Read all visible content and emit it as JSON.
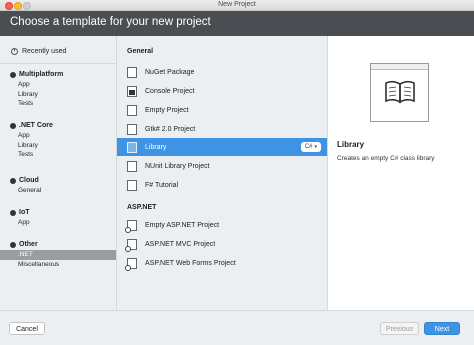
{
  "window": {
    "title": "New Project"
  },
  "header": {
    "title": "Choose a template for your new project"
  },
  "sidebar": {
    "recent_label": "Recently used",
    "groups": [
      {
        "label": "Multiplatform",
        "icon": "multiplatform-icon",
        "items": [
          "App",
          "Library",
          "Tests"
        ]
      },
      {
        "label": ".NET Core",
        "icon": "dotnet-core-icon",
        "items": [
          "App",
          "Library",
          "Tests"
        ]
      },
      {
        "label": "Cloud",
        "icon": "cloud-icon",
        "items": [
          "General"
        ]
      },
      {
        "label": "IoT",
        "icon": "iot-icon",
        "items": [
          "App"
        ]
      },
      {
        "label": "Other",
        "icon": "other-icon",
        "items": [
          ".NET",
          "Miscellaneous"
        ]
      }
    ],
    "selected": ".NET"
  },
  "templates": {
    "sections": [
      {
        "label": "General",
        "items": [
          {
            "label": "NuGet Package",
            "icon": "nuget-package-icon"
          },
          {
            "label": "Console Project",
            "icon": "console-project-icon"
          },
          {
            "label": "Empty Project",
            "icon": "empty-project-icon"
          },
          {
            "label": "Gtk# 2.0 Project",
            "icon": "gtk-project-icon"
          },
          {
            "label": "Library",
            "icon": "library-icon",
            "selected": true,
            "language": "C#"
          },
          {
            "label": "NUnit Library Project",
            "icon": "nunit-project-icon"
          },
          {
            "label": "F# Tutorial",
            "icon": "fsharp-tutorial-icon"
          }
        ]
      },
      {
        "label": "ASP.NET",
        "items": [
          {
            "label": "Empty ASP.NET Project",
            "icon": "aspnet-empty-icon"
          },
          {
            "label": "ASP.NET MVC Project",
            "icon": "aspnet-mvc-icon"
          },
          {
            "label": "ASP.NET Web Forms Project",
            "icon": "aspnet-webforms-icon"
          }
        ]
      }
    ]
  },
  "detail": {
    "title": "Library",
    "description": "Creates an empty C# class library",
    "preview_icon": "book-icon"
  },
  "footer": {
    "cancel": "Cancel",
    "previous": "Previous",
    "next": "Next"
  },
  "colors": {
    "accent": "#3f93e5",
    "header": "#4a4d52",
    "sidebar_selected": "#999da2"
  }
}
